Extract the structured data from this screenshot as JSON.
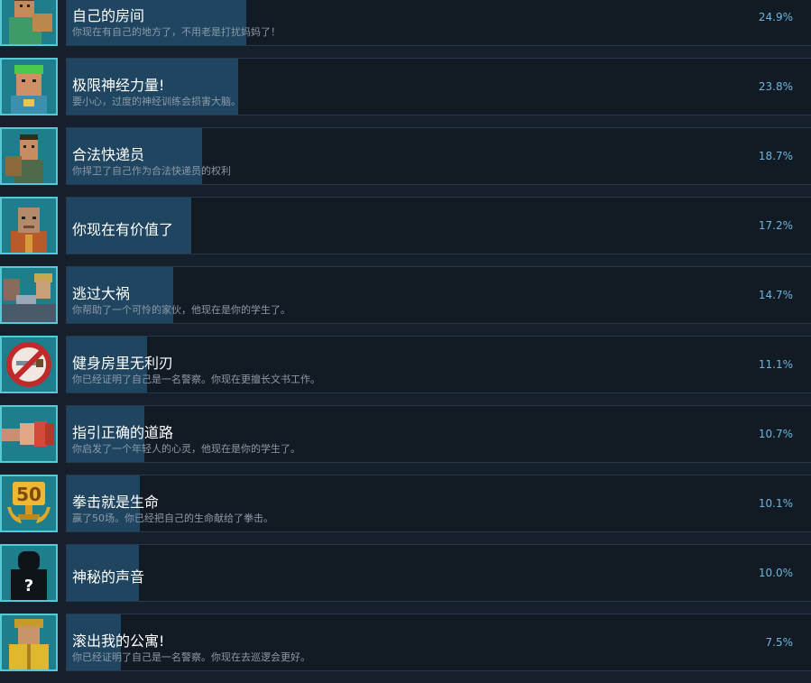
{
  "colors": {
    "background": "#16202d",
    "card": "#121a24",
    "progress_fill": "#1f4560",
    "icon_frame": "#55c9d6",
    "percent_text": "#6bb6e0"
  },
  "achievements": [
    {
      "title": "自己的房间",
      "description": "你现在有自己的地方了，不用老是打扰妈妈了！",
      "percent": "24.9%",
      "rate": 0.249,
      "icon": "man-with-bag-icon"
    },
    {
      "title": "极限神经力量!",
      "description": "要小心，过度的神经训练会损害大脑。",
      "percent": "23.8%",
      "rate": 0.238,
      "icon": "green-haired-man-icon"
    },
    {
      "title": "合法快递员",
      "description": "你捍卫了自己作为合法快递员的权利",
      "percent": "18.7%",
      "rate": 0.187,
      "icon": "courier-with-bag-icon"
    },
    {
      "title": "你现在有价值了",
      "description": "",
      "percent": "17.2%",
      "rate": 0.172,
      "icon": "bald-man-icon"
    },
    {
      "title": "逃过大祸",
      "description": "你帮助了一个可怜的家伙，他现在是你的学生了。",
      "percent": "14.7%",
      "rate": 0.147,
      "icon": "group-of-people-icon"
    },
    {
      "title": "健身房里无利刃",
      "description": "你已经证明了自己是一名警察。你现在更擅长文书工作。",
      "percent": "11.1%",
      "rate": 0.111,
      "icon": "no-knife-icon"
    },
    {
      "title": "指引正确的道路",
      "description": "你启发了一个年轻人的心灵，他现在是你的学生了。",
      "percent": "10.7%",
      "rate": 0.107,
      "icon": "fist-punch-icon"
    },
    {
      "title": "拳击就是生命",
      "description": "赢了50场。你已经把自己的生命献给了拳击。",
      "percent": "10.1%",
      "rate": 0.101,
      "icon": "fifty-trophy-icon"
    },
    {
      "title": "神秘的声音",
      "description": "",
      "percent": "10.0%",
      "rate": 0.1,
      "icon": "mystery-silhouette-icon"
    },
    {
      "title": "滚出我的公寓!",
      "description": "你已经证明了自己是一名警察。你现在去巡逻会更好。",
      "percent": "7.5%",
      "rate": 0.075,
      "icon": "man-in-raincoat-icon"
    }
  ]
}
